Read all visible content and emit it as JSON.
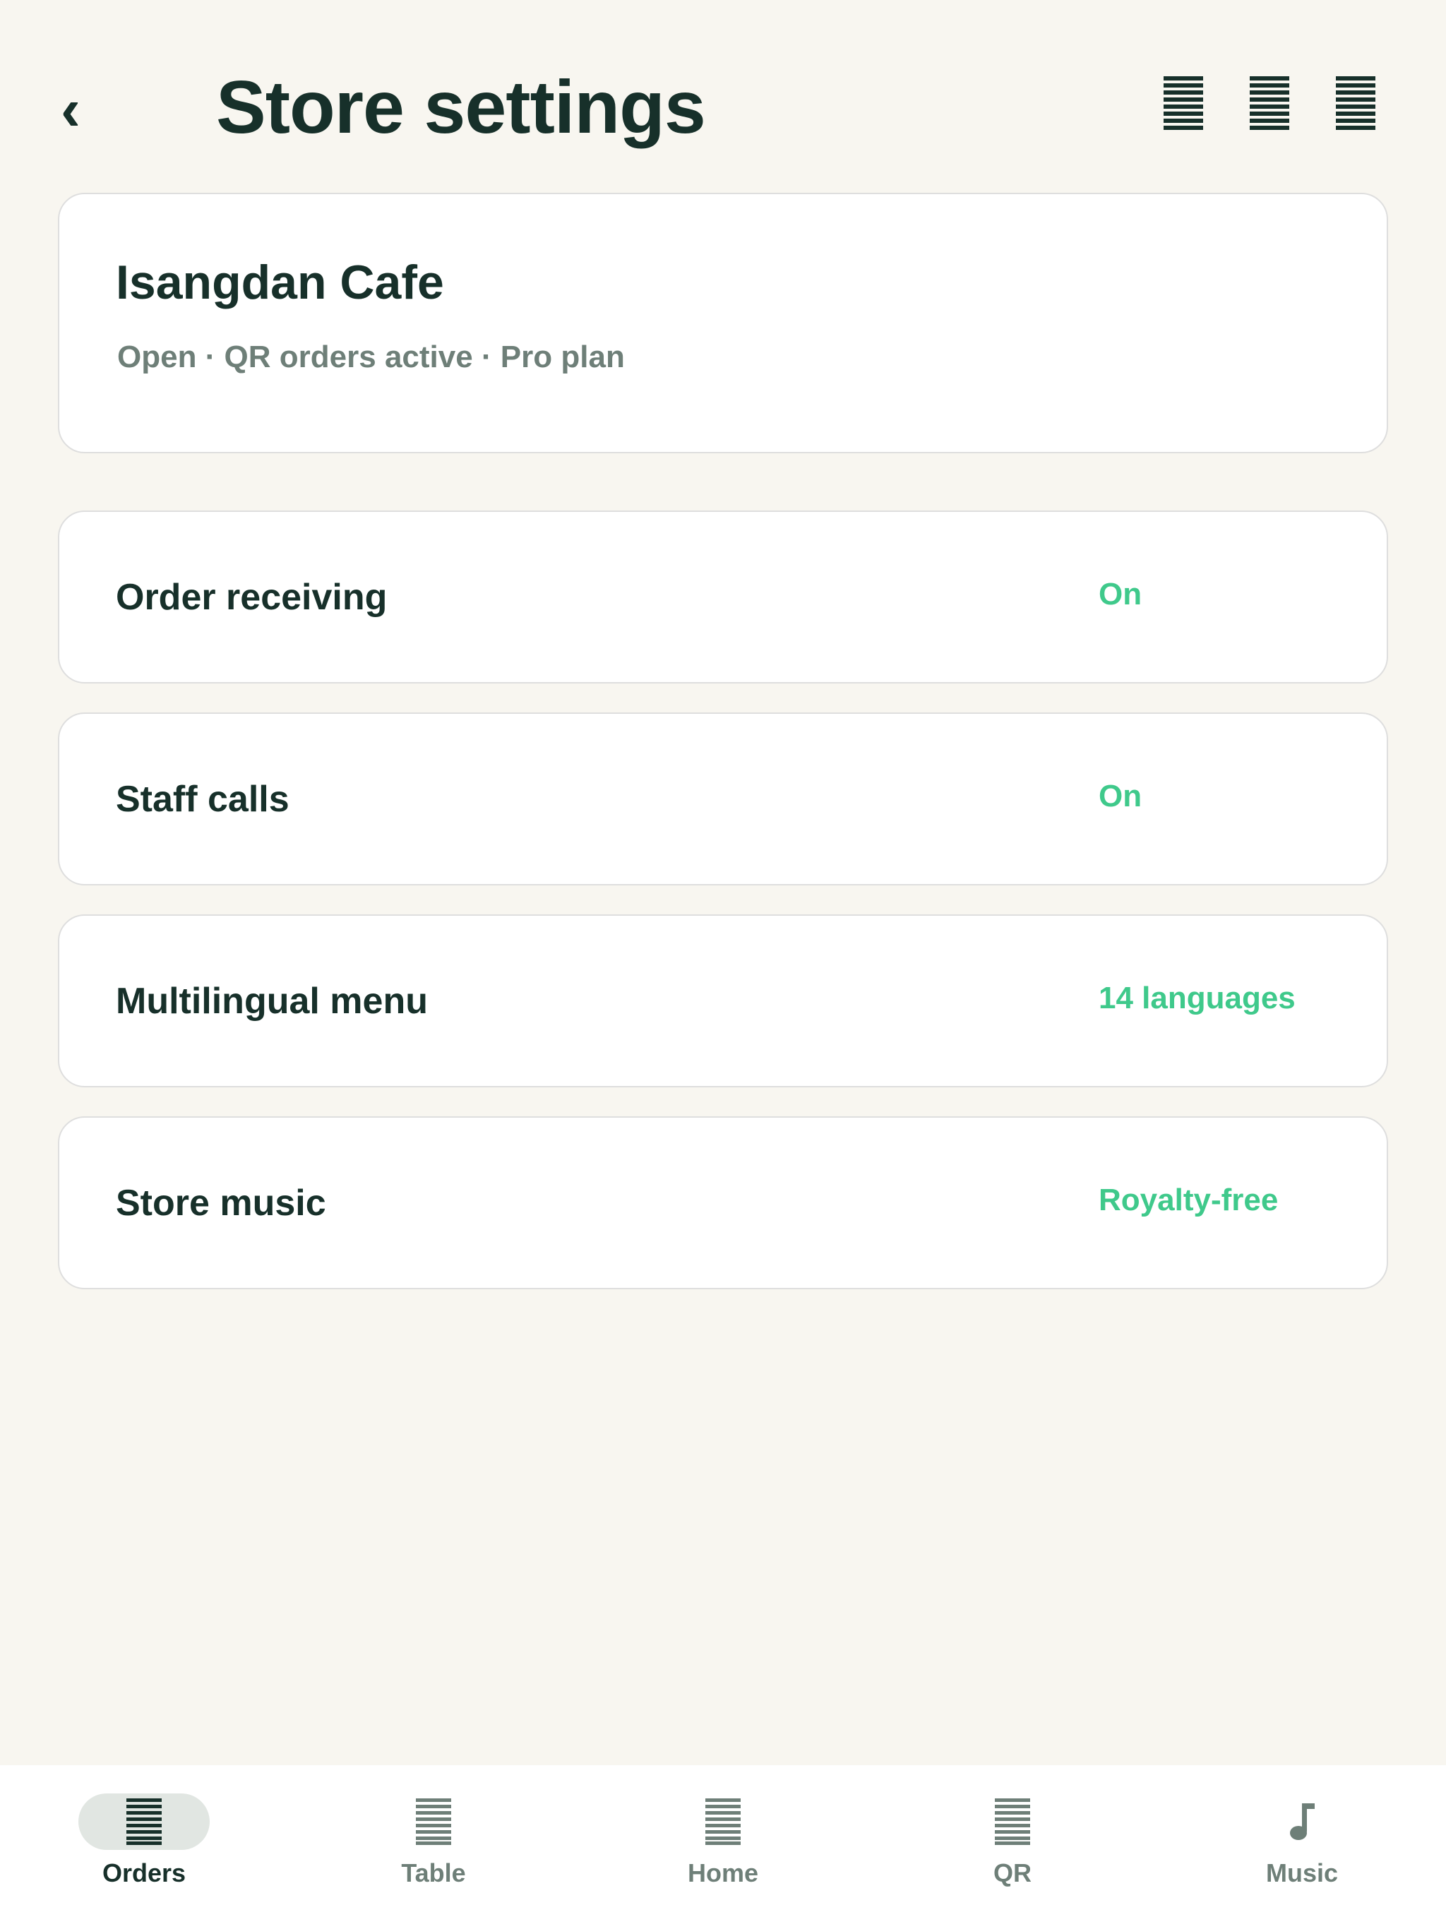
{
  "header": {
    "back_glyph": "‹",
    "title": "Store settings",
    "icons": [
      "menu-icon",
      "menu-icon",
      "menu-icon"
    ]
  },
  "store": {
    "name": "Isangdan Cafe",
    "status": "Open · QR orders active · Pro plan"
  },
  "settings": [
    {
      "label": "Order receiving",
      "value": "On"
    },
    {
      "label": "Staff calls",
      "value": "On"
    },
    {
      "label": "Multilingual menu",
      "value": "14 languages"
    },
    {
      "label": "Store music",
      "value": "Royalty-free"
    }
  ],
  "nav": {
    "items": [
      {
        "label": "Orders",
        "icon": "list-icon",
        "active": true
      },
      {
        "label": "Table",
        "icon": "list-icon",
        "active": false
      },
      {
        "label": "Home",
        "icon": "list-icon",
        "active": false
      },
      {
        "label": "QR",
        "icon": "list-icon",
        "active": false
      },
      {
        "label": "Music",
        "icon": "music-note-icon",
        "active": false
      }
    ]
  },
  "colors": {
    "background": "#f8f6f0",
    "text_primary": "#17302a",
    "text_secondary": "#6e7f78",
    "accent": "#3fc98b",
    "card": "#ffffff",
    "nav_active_pill": "#e1e6e2"
  }
}
